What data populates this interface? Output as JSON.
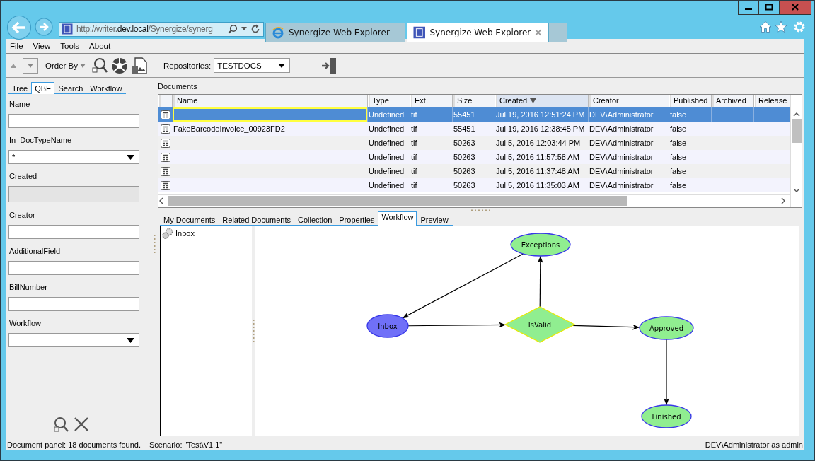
{
  "browser": {
    "address": "http://writer.**dev.local**/Synergize/synerg",
    "tabs": [
      {
        "title": "Synergize Web Explorer",
        "selected": false,
        "kind": "ie"
      },
      {
        "title": "Synergize Web Explorer",
        "selected": true,
        "kind": "app"
      }
    ]
  },
  "menu": [
    "File",
    "View",
    "Tools",
    "About"
  ],
  "toolbar": {
    "order_by": "Order By",
    "repositories_label": "Repositories:",
    "repository": "TESTDOCS"
  },
  "left_tabs": [
    {
      "label": "Tree",
      "selected": false
    },
    {
      "label": "QBE",
      "selected": true
    },
    {
      "label": "Search",
      "selected": false
    },
    {
      "label": "Workflow",
      "selected": false
    }
  ],
  "fields": [
    {
      "label": "Name",
      "kind": "text",
      "disabled": false
    },
    {
      "label": "In_DocTypeName",
      "kind": "select",
      "value": "*",
      "disabled": false
    },
    {
      "label": "Created",
      "kind": "text",
      "disabled": true
    },
    {
      "label": "Creator",
      "kind": "text",
      "disabled": false
    },
    {
      "label": "AdditionalField",
      "kind": "text",
      "disabled": false
    },
    {
      "label": "BillNumber",
      "kind": "text",
      "disabled": false
    },
    {
      "label": "Workflow",
      "kind": "select",
      "disabled": false
    }
  ],
  "documents": {
    "title": "Documents",
    "columns": [
      {
        "label": "Name",
        "sorted": false
      },
      {
        "label": "Type",
        "sorted": false
      },
      {
        "label": "Ext.",
        "sorted": false
      },
      {
        "label": "Size",
        "sorted": false
      },
      {
        "label": "Created",
        "sorted": true
      },
      {
        "label": "Creator",
        "sorted": false
      },
      {
        "label": "Published",
        "sorted": false
      },
      {
        "label": "Archived",
        "sorted": false
      },
      {
        "label": "Release",
        "sorted": false
      }
    ],
    "rows": [
      {
        "selected": true,
        "type": "Undefined",
        "ext": "tif",
        "size": "55451",
        "created": "Jul 19, 2016 12:51:24 PM",
        "creator": "DEV\\Administrator",
        "published": "false"
      },
      {
        "selected": false,
        "name": "FakeBarcodeInvoice_00923FD2",
        "type": "Undefined",
        "ext": "tif",
        "size": "55451",
        "created": "Jul 19, 2016 12:38:45 PM",
        "creator": "DEV\\Administrator",
        "published": "false"
      },
      {
        "selected": false,
        "type": "Undefined",
        "ext": "tif",
        "size": "50263",
        "created": "Jul 5, 2016 12:03:44 PM",
        "creator": "DEV\\Administrator",
        "published": "false"
      },
      {
        "selected": false,
        "type": "Undefined",
        "ext": "tif",
        "size": "50263",
        "created": "Jul 5, 2016 11:57:58 AM",
        "creator": "DEV\\Administrator",
        "published": "false"
      },
      {
        "selected": false,
        "type": "Undefined",
        "ext": "tif",
        "size": "50263",
        "created": "Jul 5, 2016 11:37:48 AM",
        "creator": "DEV\\Administrator",
        "published": "false"
      },
      {
        "selected": false,
        "type": "Undefined",
        "ext": "tif",
        "size": "50263",
        "created": "Jul 5, 2016 11:35:03 AM",
        "creator": "DEV\\Administrator",
        "published": "false"
      }
    ]
  },
  "bottom_tabs": [
    {
      "label": "My Documents",
      "selected": false
    },
    {
      "label": "Related Documents",
      "selected": false
    },
    {
      "label": "Collection",
      "selected": false
    },
    {
      "label": "Properties",
      "selected": false
    },
    {
      "label": "Workflow",
      "selected": true
    },
    {
      "label": "Preview",
      "selected": false
    }
  ],
  "workflow_tree": [
    {
      "label": "Inbox"
    }
  ],
  "workflow": {
    "nodes": [
      {
        "label": "Exceptions",
        "kind": "ellipse",
        "color": "#90ee90"
      },
      {
        "label": "Inbox",
        "kind": "ellipse",
        "color": "#7070f8"
      },
      {
        "label": "IsValid",
        "kind": "diamond",
        "color": "#90ee90"
      },
      {
        "label": "Approved",
        "kind": "ellipse",
        "color": "#90ee90"
      },
      {
        "label": "Finished",
        "kind": "ellipse",
        "color": "#90ee90"
      }
    ]
  },
  "status_bar": {
    "left": "Document panel: 18 documents found.",
    "scenario": "Scenario: \"Test\\V1.1\"",
    "user": "DEV\\Administrator as admin"
  }
}
